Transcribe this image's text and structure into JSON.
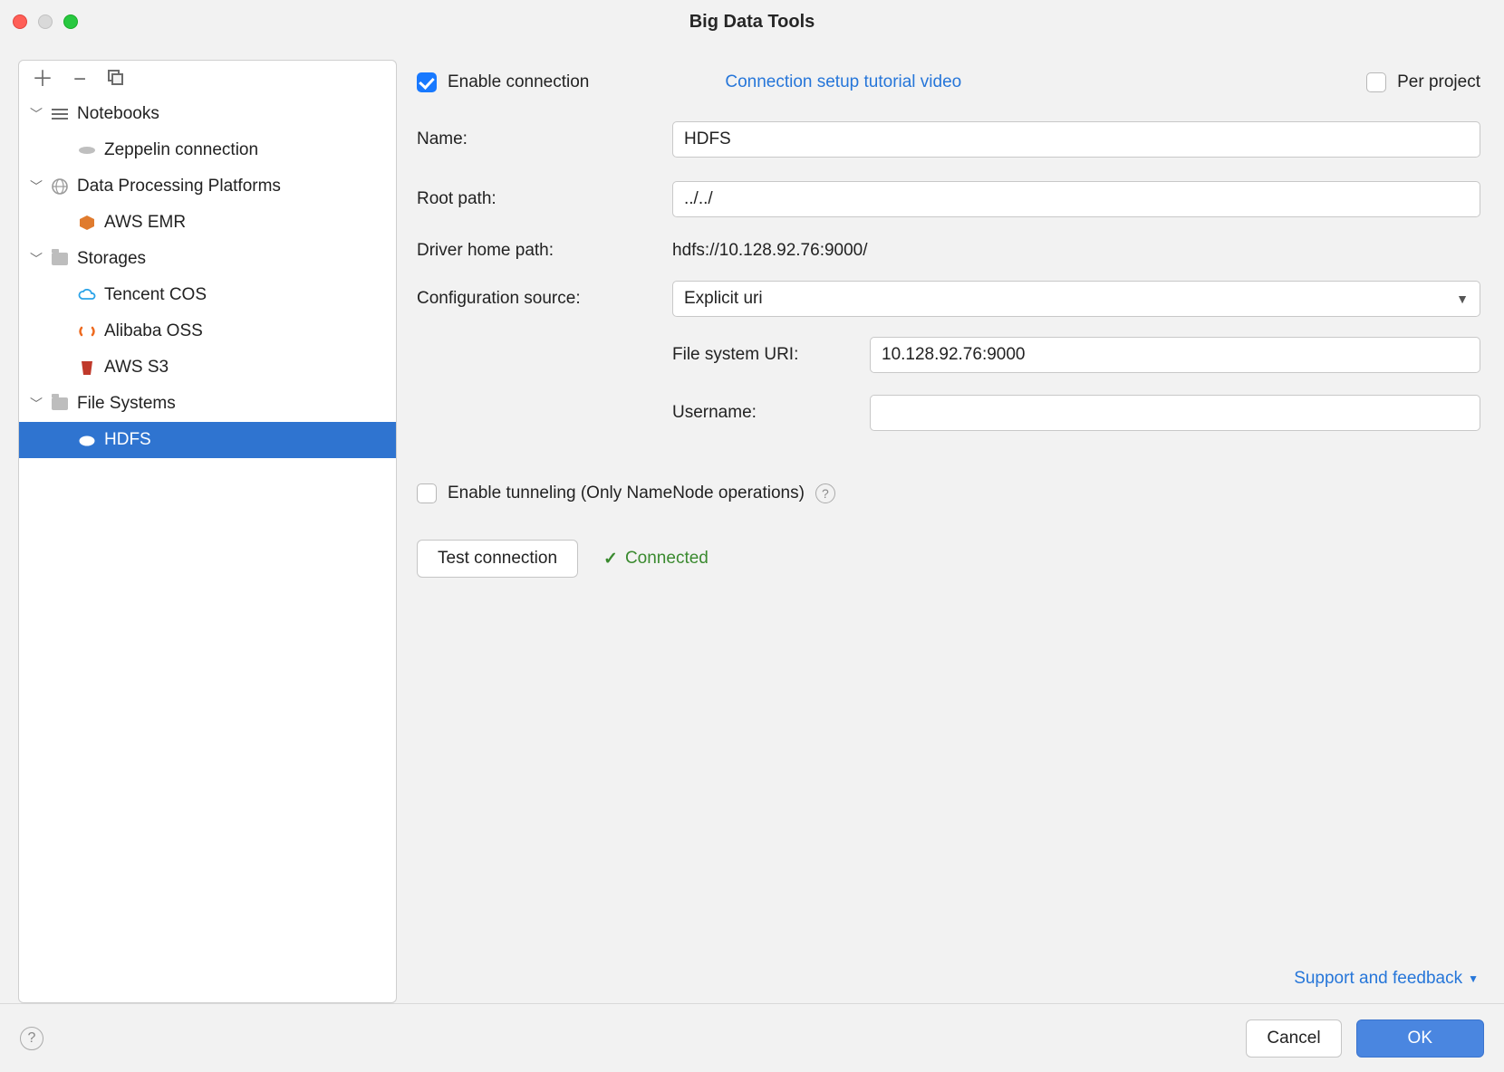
{
  "title": "Big Data Tools",
  "sidebar": {
    "groups": [
      {
        "label": "Notebooks",
        "items": [
          {
            "label": "Zeppelin connection",
            "icon": "zeppelin"
          }
        ]
      },
      {
        "label": "Data Processing Platforms",
        "items": [
          {
            "label": "AWS EMR",
            "icon": "aws"
          }
        ]
      },
      {
        "label": "Storages",
        "items": [
          {
            "label": "Tencent COS",
            "icon": "tencent"
          },
          {
            "label": "Alibaba OSS",
            "icon": "alibaba"
          },
          {
            "label": "AWS S3",
            "icon": "s3"
          }
        ]
      },
      {
        "label": "File Systems",
        "items": [
          {
            "label": "HDFS",
            "icon": "hdfs",
            "selected": true
          }
        ]
      }
    ]
  },
  "main": {
    "enable_connection_label": "Enable connection",
    "enable_connection_checked": true,
    "tutorial_link": "Connection setup tutorial video",
    "per_project_label": "Per project",
    "per_project_checked": false,
    "name_label": "Name:",
    "name_value": "HDFS",
    "root_path_label": "Root path:",
    "root_path_value": "../../",
    "driver_home_label": "Driver home path:",
    "driver_home_value": "hdfs://10.128.92.76:9000/",
    "config_source_label": "Configuration source:",
    "config_source_value": "Explicit uri",
    "fs_uri_label": "File system URI:",
    "fs_uri_value": "10.128.92.76:9000",
    "username_label": "Username:",
    "username_value": "",
    "tunneling_label": "Enable tunneling (Only NameNode operations)",
    "tunneling_checked": false,
    "test_button": "Test connection",
    "status_text": "Connected",
    "support_link": "Support and feedback"
  },
  "footer": {
    "cancel": "Cancel",
    "ok": "OK"
  }
}
